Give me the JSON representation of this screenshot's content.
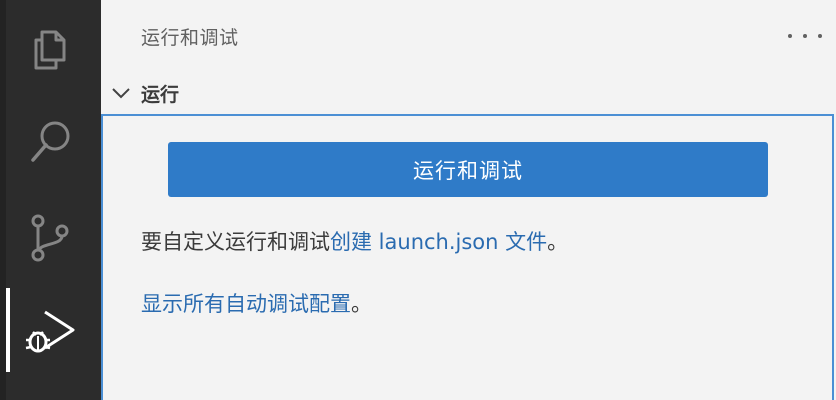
{
  "activity_bar": {
    "items": [
      {
        "name": "explorer",
        "icon": "files-icon",
        "active": false
      },
      {
        "name": "search",
        "icon": "search-icon",
        "active": false
      },
      {
        "name": "source-control",
        "icon": "source-control-icon",
        "active": false
      },
      {
        "name": "run-and-debug",
        "icon": "run-debug-icon",
        "active": true
      }
    ]
  },
  "sidebar": {
    "title": "运行和调试",
    "more_actions_icon": "ellipsis-icon",
    "section": {
      "label": "运行",
      "expanded": true,
      "run_button_label": "运行和调试",
      "customize_prefix": "要自定义运行和调试",
      "create_link": "创建 launch.json 文件",
      "customize_suffix": "。",
      "show_all_link": "显示所有自动调试配置",
      "show_all_suffix": "。"
    }
  },
  "colors": {
    "activity_bar_bg": "#2c2c2c",
    "sidebar_bg": "#f3f3f3",
    "button_bg": "#2f7bc8",
    "link": "#2a6bb0",
    "focus_border": "#4b8fd4"
  }
}
